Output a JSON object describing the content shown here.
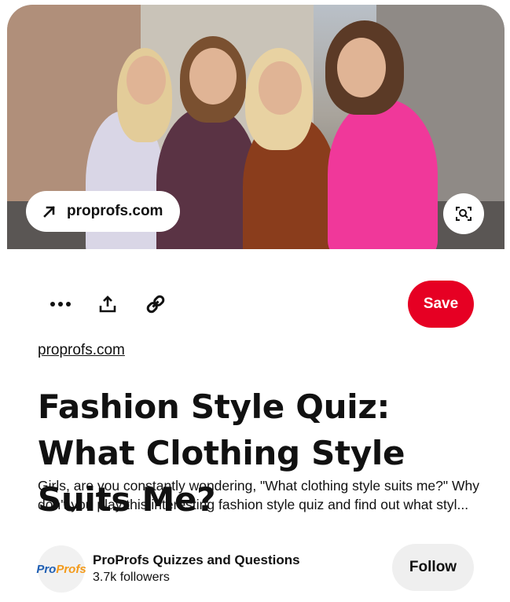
{
  "pin": {
    "source_pill_label": "proprofs.com",
    "domain_link": "proprofs.com",
    "title": "Fashion Style Quiz: What Clothing Style Suits Me?",
    "description": "Girls, are you constantly wondering, \"What clothing style suits me?\" Why don't you play this interesting fashion style quiz and find out what styl...",
    "save_label": "Save"
  },
  "icons": {
    "source": "arrow-up-right-icon",
    "lens": "visual-search-icon",
    "more": "more-dots-icon",
    "share": "share-icon",
    "link": "link-icon"
  },
  "author": {
    "name": "ProProfs Quizzes and Questions",
    "followers": "3.7k followers",
    "logo_text_a": "Pro",
    "logo_text_b": "Profs",
    "follow_label": "Follow"
  },
  "colors": {
    "save": "#e60023",
    "follow": "#efefef"
  }
}
